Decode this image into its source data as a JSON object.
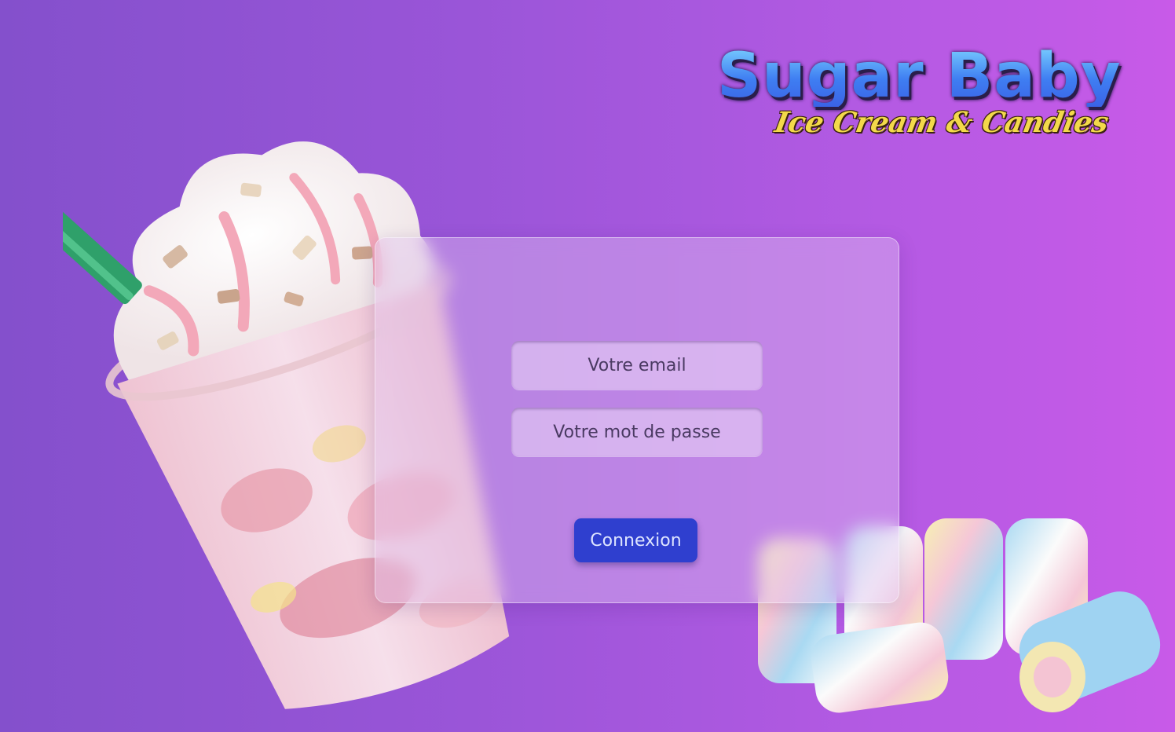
{
  "logo": {
    "title": "Sugar Baby",
    "tagline": "Ice Cream & Candies"
  },
  "login": {
    "email_placeholder": "Votre email",
    "password_placeholder": "Votre mot de passe",
    "submit_label": "Connexion"
  },
  "colors": {
    "background_start": "#8450cc",
    "background_end": "#c85ae8",
    "button": "#2f3fcf",
    "logo_blue": "#3f7ef2",
    "logo_yellow": "#f3d94a"
  }
}
